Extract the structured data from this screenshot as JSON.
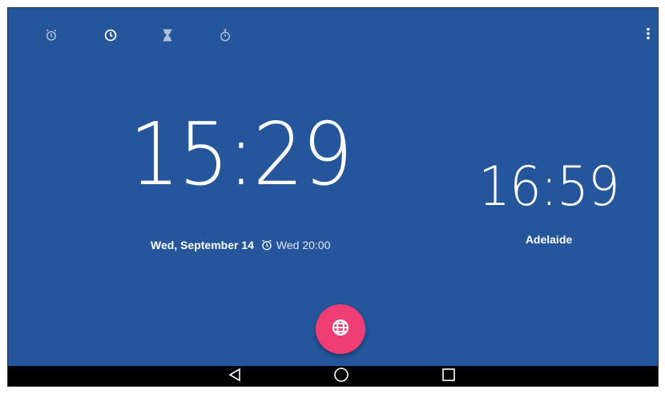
{
  "colors": {
    "background": "#25569b",
    "fab": "#ef3e73",
    "tab_inactive": "#aebfd9",
    "tab_active": "#ffffff"
  },
  "tabs": [
    {
      "icon": "alarm-clock-icon",
      "active": false
    },
    {
      "icon": "clock-icon",
      "active": true
    },
    {
      "icon": "hourglass-icon",
      "active": false
    },
    {
      "icon": "stopwatch-icon",
      "active": false
    }
  ],
  "overflow_menu": {
    "icon": "more-vert-icon"
  },
  "clock": {
    "time": "15:29",
    "date": "Wed, September 14",
    "next_alarm": "Wed 20:00"
  },
  "world_clock": {
    "time": "16:59",
    "city": "Adelaide"
  },
  "fab": {
    "icon": "globe-icon"
  },
  "nav": {
    "back": "back-icon",
    "home": "home-icon",
    "recents": "recents-icon"
  }
}
